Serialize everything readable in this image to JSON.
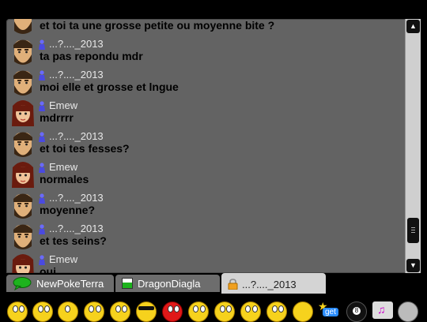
{
  "messages": [
    {
      "user": "",
      "text": "et toi ta une grosse petite ou moyenne bite ?",
      "avatar": "bearded-man-avatar"
    },
    {
      "user": "...?...._2013",
      "text": "ta pas repondu mdr",
      "avatar": "bearded-man-avatar"
    },
    {
      "user": "...?...._2013",
      "text": "moi elle et grosse et lngue",
      "avatar": "bearded-man-avatar"
    },
    {
      "user": "Emew",
      "text": "mdrrrr",
      "avatar": "girl-avatar"
    },
    {
      "user": "...?...._2013",
      "text": "et toi tes fesses?",
      "avatar": "bearded-man-avatar"
    },
    {
      "user": "Emew",
      "text": "normales",
      "avatar": "girl-avatar"
    },
    {
      "user": "...?...._2013",
      "text": "moyenne?",
      "avatar": "bearded-man-avatar"
    },
    {
      "user": "...?...._2013",
      "text": "et tes seins?",
      "avatar": "bearded-man-avatar"
    },
    {
      "user": "Emew",
      "text": "oui",
      "avatar": "girl-avatar"
    }
  ],
  "tabs": [
    {
      "label": "NewPokeTerra",
      "icon": "speech-bubble-icon",
      "active": false
    },
    {
      "label": "DragonDiagla",
      "icon": "green-window-icon",
      "active": false
    },
    {
      "label": "...?...._2013",
      "icon": "lock-icon",
      "active": true
    }
  ],
  "smileys_get_label": "get",
  "colors": {
    "chat_bg": "#636363",
    "tab_active": "#d4d4d4",
    "tab_inactive": "#6d6d6d",
    "smiley_yellow": "#f6d21d"
  }
}
